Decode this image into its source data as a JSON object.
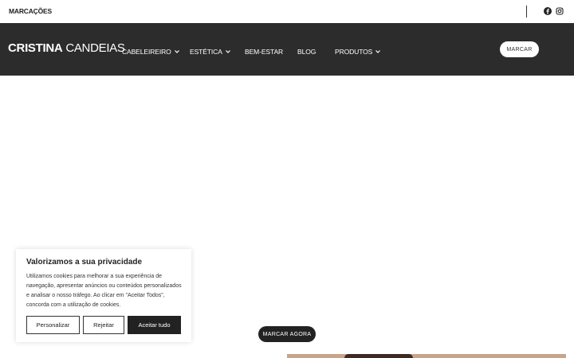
{
  "topbar": {
    "link_label": "MARCAÇÕES",
    "social": [
      "facebook-icon",
      "instagram-icon"
    ]
  },
  "navbar": {
    "logo_first": "CRISTINA",
    "logo_second": "CANDEIAS",
    "menu": [
      {
        "label": "CABELEIREIRO",
        "has_dropdown": true
      },
      {
        "label": "ESTÉTICA",
        "has_dropdown": true
      },
      {
        "label": "BEM-ESTAR",
        "has_dropdown": false
      },
      {
        "label": "BLOG",
        "has_dropdown": false
      },
      {
        "label": "PRODUTOS",
        "has_dropdown": true
      }
    ],
    "cta_label": "MARCAR"
  },
  "cookie": {
    "title": "Valorizamos a sua privacidade",
    "text": "Utilizamos cookies para melhorar a sua experiência de navegação, apresentar anúncios ou conteúdos personalizados e analisar o nosso tráfego. Ao clicar em \"Aceitar Todos\", concorda com a utilização de cookies.",
    "customize_label": "Personalizar",
    "reject_label": "Rejeitar",
    "accept_label": "Aceitar tudo"
  },
  "hero": {
    "cta_label": "MARCAR AGORA"
  },
  "colors": {
    "navbar_bg": "#2c2c2c",
    "accent_dark": "#222222",
    "photo_skin": "#c8a58a"
  }
}
